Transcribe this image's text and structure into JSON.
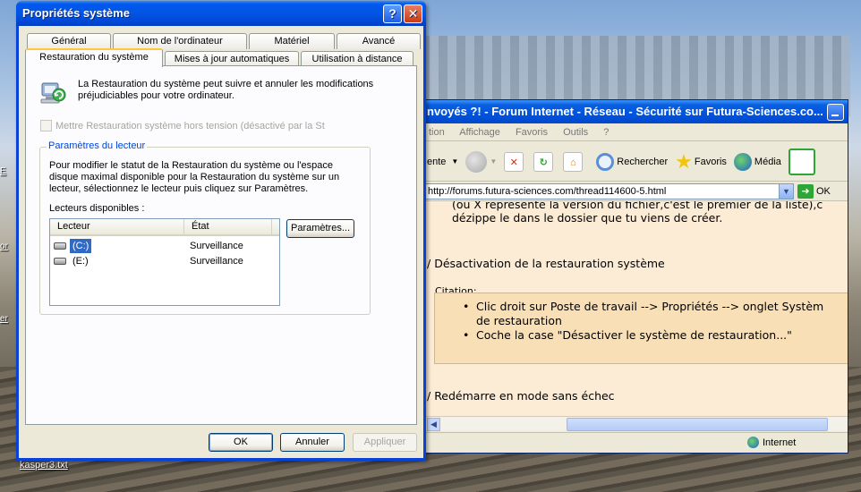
{
  "desktop": {
    "file_icon_label": "kasper3.txt",
    "left_labels": [
      "E",
      "or",
      "er"
    ]
  },
  "browser": {
    "title": "nvoyés ?! - Forum Internet - Réseau - Sécurité sur Futura-Sciences.co...",
    "menu": [
      "tion",
      "Affichage",
      "Favoris",
      "Outils",
      "?"
    ],
    "toolbar": {
      "back_fragment": "ente",
      "search": "Rechercher",
      "favorites": "Favoris",
      "media": "Média"
    },
    "address": {
      "url": "http://forums.futura-sciences.com/thread114600-5.html",
      "go": "OK"
    },
    "content": {
      "line1": "(où X représente la version du fichier,c'est le premier de la liste),c",
      "line2": "dézippe le dans le dossier que tu viens de créer.",
      "heading1": "Désactivation de la restauration système",
      "citation_label": "Citation:",
      "bullet1a": "Clic droit sur Poste de travail --> Propriétés --> onglet Systèm",
      "bullet1b": "de restauration",
      "bullet2": "Coche la case \"Désactiver le système de restauration...\"",
      "heading2": "Redémarre en mode sans échec",
      "line_cut": "... ... ..."
    },
    "status": {
      "zone": "Internet"
    }
  },
  "dialog": {
    "title": "Propriétés système",
    "tabs_row1": [
      "Général",
      "Nom de l'ordinateur",
      "Matériel",
      "Avancé"
    ],
    "tabs_row2": [
      "Restauration du système",
      "Mises à jour automatiques",
      "Utilisation à distance"
    ],
    "active_tab": "Restauration du système",
    "intro": "La Restauration du système peut suivre et annuler les modifications préjudiciables pour votre ordinateur.",
    "disable_checkbox": "Mettre Restauration système hors tension (désactivé par la St",
    "group": {
      "legend": "Paramètres du lecteur",
      "description": "Pour modifier le statut de la Restauration du système ou l'espace disque maximal disponible pour la Restauration du système sur un lecteur, sélectionnez le lecteur puis cliquez sur Paramètres.",
      "drives_label": "Lecteurs disponibles :",
      "columns": [
        "Lecteur",
        "État"
      ],
      "drives": [
        {
          "name": "(C:)",
          "state": "Surveillance",
          "selected": true
        },
        {
          "name": "(E:)",
          "state": "Surveillance",
          "selected": false
        }
      ],
      "settings_button": "Paramètres..."
    },
    "buttons": {
      "ok": "OK",
      "cancel": "Annuler",
      "apply": "Appliquer"
    }
  }
}
